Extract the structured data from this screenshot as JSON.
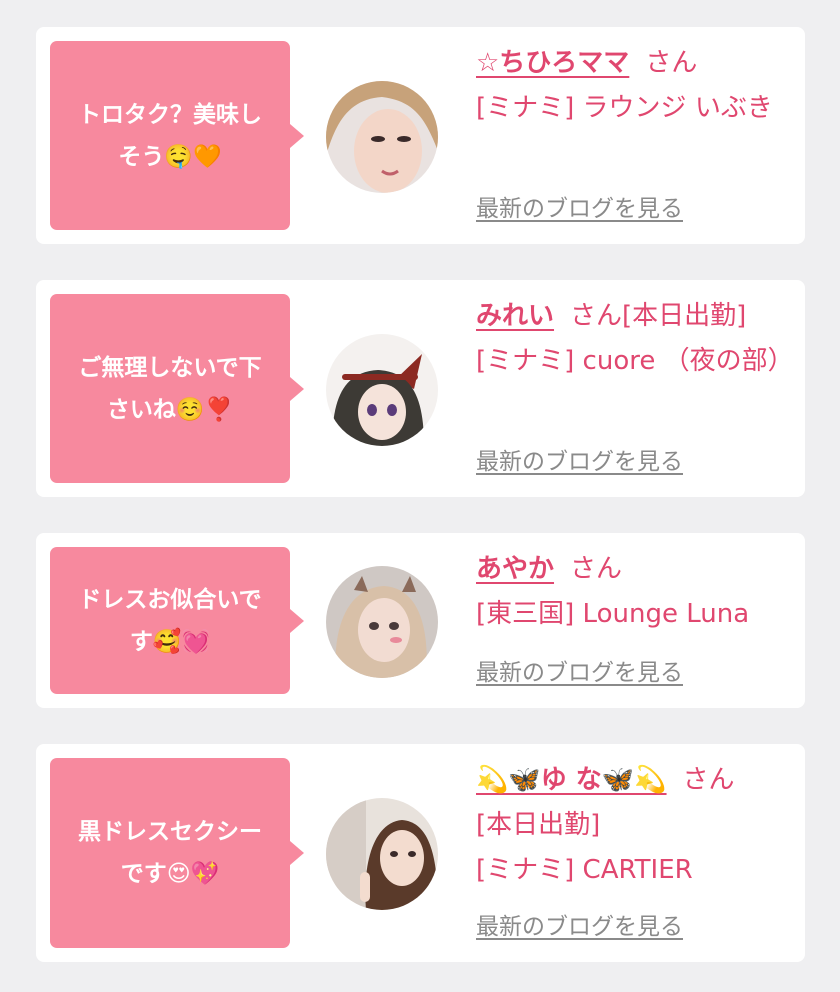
{
  "cards": [
    {
      "comment": "トロタク？美味しそう🤤🧡",
      "name": "☆ちひろママ",
      "san": "さん",
      "tag": "",
      "location": "[ミナミ] ラウンジ いぶき",
      "blog_link": "最新のブログを見る"
    },
    {
      "comment": "ご無理しないで下さいね☺️❣️",
      "name": "みれい",
      "san": "さん",
      "tag": "[本日出勤]",
      "location": "[ミナミ] cuore （夜の部）",
      "blog_link": "最新のブログを見る"
    },
    {
      "comment": "ドレスお似合いです🥰💓",
      "name": "あやか",
      "san": "さん",
      "tag": "",
      "location": "[東三国] Lounge Luna",
      "blog_link": "最新のブログを見る"
    },
    {
      "comment": "黒ドレスセクシーです😍💖",
      "name": "💫🦋ゆ な🦋💫",
      "san": "さん",
      "tag": "[本日出勤]",
      "location": "[ミナミ] CARTIER",
      "blog_link": "最新のブログを見る"
    }
  ],
  "colors": {
    "page_bg": "#efeff1",
    "card_bg": "#ffffff",
    "bubble": "#f7899e",
    "accent_text": "#e0476f",
    "link_gray": "#8a8a8a"
  }
}
